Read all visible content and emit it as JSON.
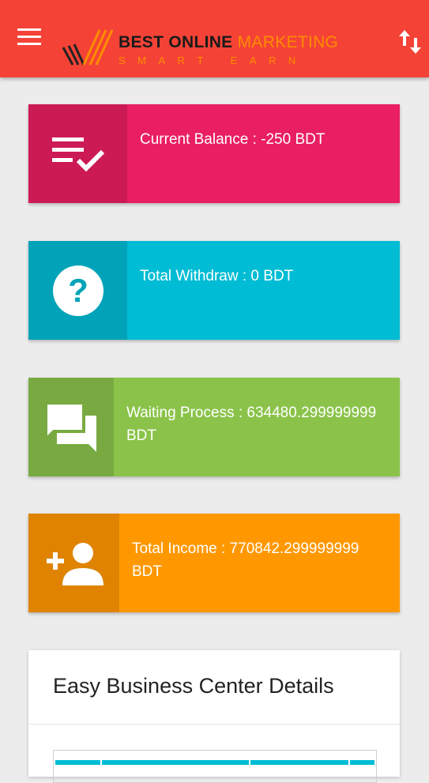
{
  "header": {
    "brand_word1": "BEST",
    "brand_word2": "ONLINE",
    "brand_word3": "MARKETING",
    "tagline": "SMART EARN"
  },
  "cards": [
    {
      "label": "Current Balance : -250 BDT",
      "icon": "playlist-check-icon"
    },
    {
      "label": "Total Withdraw : 0 BDT",
      "icon": "help-circle-icon"
    },
    {
      "label": "Waiting Process : 634480.299999999 BDT",
      "icon": "forum-icon"
    },
    {
      "label": "Total Income : 770842.299999999 BDT",
      "icon": "person-add-icon"
    }
  ],
  "details": {
    "title": "Easy Business Center Details"
  },
  "colors": {
    "appbar": "#f44336",
    "balance": "#e91e63",
    "withdraw": "#00bcd4",
    "waiting": "#8bc34a",
    "income": "#ff9800"
  }
}
